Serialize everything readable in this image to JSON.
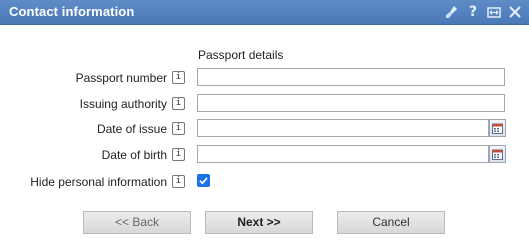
{
  "window": {
    "title": "Contact information",
    "icons": [
      "clean-icon",
      "help-icon",
      "maximize-icon",
      "close-icon"
    ],
    "help_label": "?"
  },
  "form": {
    "section_header": "Passport details",
    "fields": {
      "passport_number": {
        "label": "Passport number",
        "value": ""
      },
      "issuing_authority": {
        "label": "Issuing authority",
        "value": ""
      },
      "date_of_issue": {
        "label": "Date of issue",
        "value": ""
      },
      "date_of_birth": {
        "label": "Date of birth",
        "value": ""
      },
      "hide_personal_info": {
        "label": "Hide personal information",
        "checked": true
      }
    },
    "info_glyph": "i"
  },
  "buttons": {
    "back": "<< Back",
    "next": "Next >>",
    "cancel": "Cancel"
  },
  "colors": {
    "titlebar": "#4a79b8",
    "checkbox": "#1a73e8"
  }
}
